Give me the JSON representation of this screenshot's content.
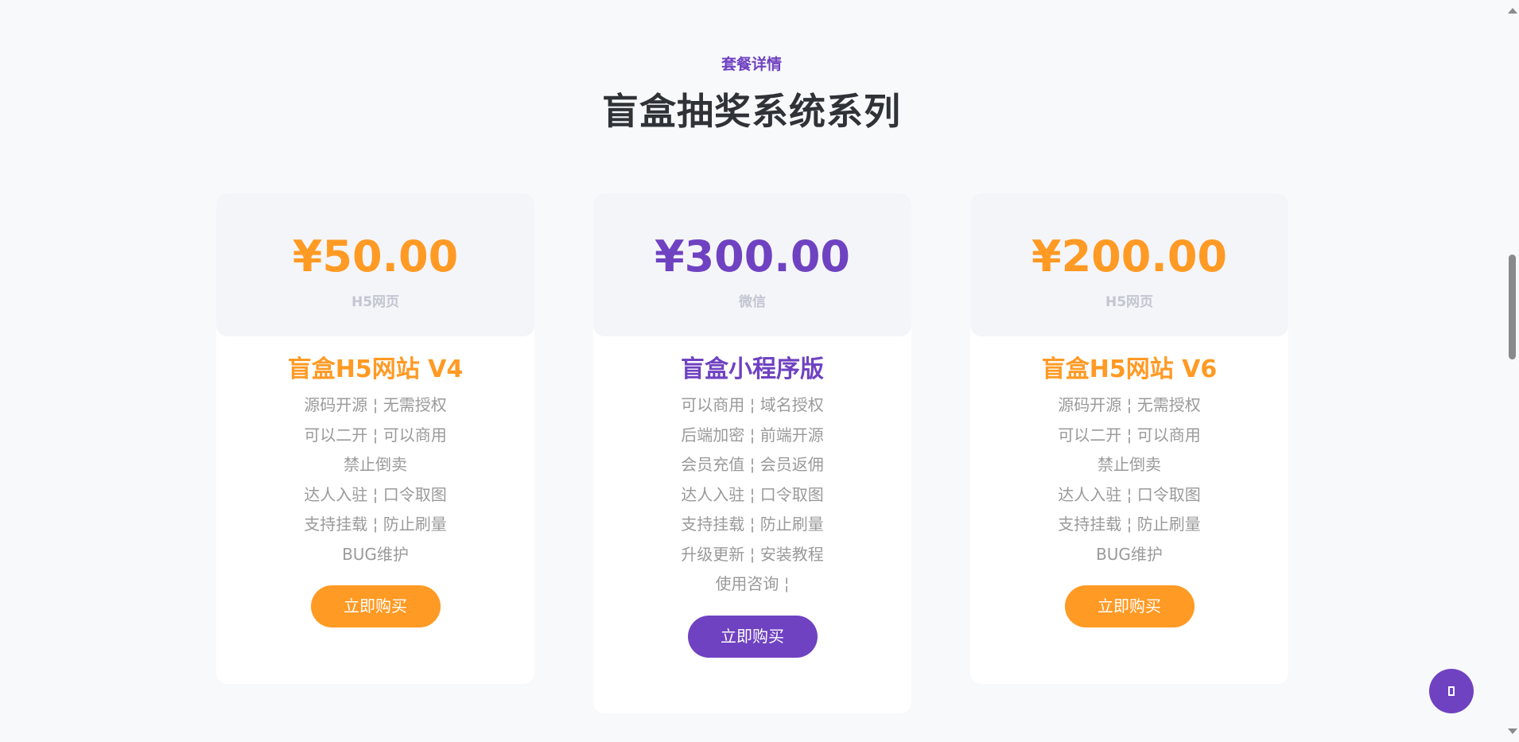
{
  "section": {
    "subtitle": "套餐详情",
    "title": "盲盒抽奖系统系列"
  },
  "colors": {
    "orange": "#ff9a24",
    "purple": "#6f42c1",
    "title": "#2f3338",
    "feature_text": "#9a9a9a",
    "platform_text": "#c3c6d1"
  },
  "cards": [
    {
      "price": "¥50.00",
      "platform": "H5网页",
      "name": "盲盒H5网站 V4",
      "features": [
        "源码开源 ¦ 无需授权",
        "可以二开 ¦ 可以商用",
        "禁止倒卖",
        "达人入驻 ¦ 口令取图",
        "支持挂载 ¦ 防止刷量",
        "BUG维护"
      ],
      "button": "立即购买",
      "accent": "orange"
    },
    {
      "price": "¥300.00",
      "platform": "微信",
      "name": "盲盒小程序版",
      "features": [
        "可以商用 ¦ 域名授权",
        "后端加密 ¦ 前端开源",
        "会员充值 ¦ 会员返佣",
        "达人入驻 ¦ 口令取图",
        "支持挂载 ¦ 防止刷量",
        "升级更新 ¦ 安装教程",
        "使用咨询 ¦"
      ],
      "button": "立即购买",
      "accent": "purple"
    },
    {
      "price": "¥200.00",
      "platform": "H5网页",
      "name": "盲盒H5网站 V6",
      "features": [
        "源码开源 ¦ 无需授权",
        "可以二开 ¦ 可以商用",
        "禁止倒卖",
        "达人入驻 ¦ 口令取图",
        "支持挂载 ¦ 防止刷量",
        "BUG维护"
      ],
      "button": "立即购买",
      "accent": "orange"
    }
  ],
  "floating_button": {
    "icon": "chat-icon"
  }
}
